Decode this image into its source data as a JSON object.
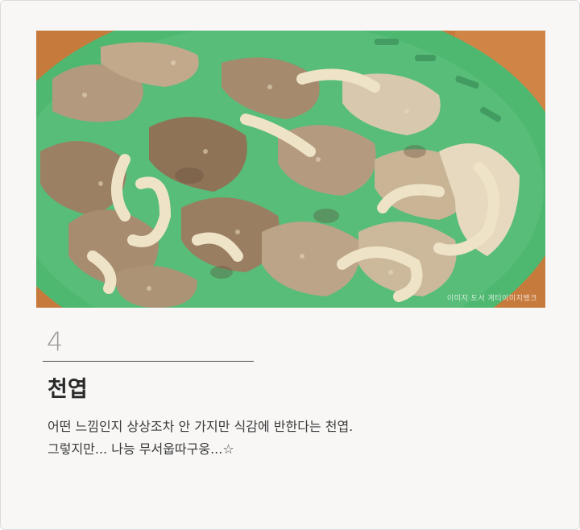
{
  "item": {
    "number": "4",
    "title": "천엽",
    "description_lines": [
      "어떤 느낌인지 상상조차 안 가지만 식감에 반한다는 천엽.",
      "그렇지만... 나능 무서웁따구웅...☆"
    ]
  },
  "photo": {
    "credit": "이미지 도서 게티이미지뱅크",
    "plate_color": "#4fb870",
    "table_color": "#c9783a"
  }
}
